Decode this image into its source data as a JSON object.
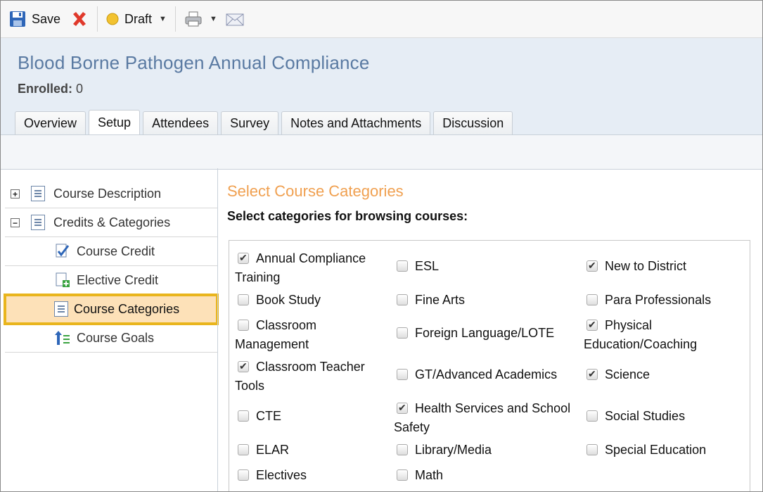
{
  "toolbar": {
    "save_label": "Save",
    "status_label": "Draft",
    "status_color": "#f2c230"
  },
  "course": {
    "title": "Blood Borne Pathogen Annual Compliance",
    "enrolled_label": "Enrolled:",
    "enrolled_count": "0"
  },
  "tabs": [
    {
      "label": "Overview"
    },
    {
      "label": "Setup",
      "active": true
    },
    {
      "label": "Attendees"
    },
    {
      "label": "Survey"
    },
    {
      "label": "Notes and Attachments"
    },
    {
      "label": "Discussion"
    }
  ],
  "sidebar": {
    "items": [
      {
        "label": "Course Description",
        "expander": "+",
        "level": "top"
      },
      {
        "label": "Credits & Categories",
        "expander": "−",
        "level": "top"
      },
      {
        "label": "Course Credit",
        "level": "sub"
      },
      {
        "label": "Elective Credit",
        "level": "sub"
      },
      {
        "label": "Course Categories",
        "level": "sub",
        "selected": true
      },
      {
        "label": "Course Goals",
        "level": "sub"
      }
    ]
  },
  "main": {
    "section_title": "Select Course Categories",
    "instructions": "Select categories for browsing courses:"
  },
  "categories": {
    "col1": [
      {
        "label1": "Annual Compliance",
        "label2": "Training",
        "checked": true
      },
      {
        "label1": "Book Study",
        "label2": "",
        "checked": false
      },
      {
        "label1": "Classroom",
        "label2": "Management",
        "checked": false
      },
      {
        "label1": "Classroom Teacher",
        "label2": "Tools",
        "checked": true
      },
      {
        "label1": "CTE",
        "label2": "",
        "checked": false
      },
      {
        "label1": "ELAR",
        "label2": "",
        "checked": false
      },
      {
        "label1": "Electives",
        "label2": "",
        "checked": false
      }
    ],
    "col2": [
      {
        "label1": "ESL",
        "label2": "",
        "checked": false
      },
      {
        "label1": "Fine Arts",
        "label2": "",
        "checked": false
      },
      {
        "label1": "Foreign Language/LOTE",
        "label2": "",
        "checked": false
      },
      {
        "label1": "GT/Advanced Academics",
        "label2": "",
        "checked": false
      },
      {
        "label1": "Health Services and School",
        "label2": "Safety",
        "checked": true
      },
      {
        "label1": "Library/Media",
        "label2": "",
        "checked": false
      },
      {
        "label1": "Math",
        "label2": "",
        "checked": false
      }
    ],
    "col3": [
      {
        "label1": "New to District",
        "label2": "",
        "checked": true
      },
      {
        "label1": "Para Professionals",
        "label2": "",
        "checked": false
      },
      {
        "label1": "Physical",
        "label2": "Education/Coaching",
        "checked": true
      },
      {
        "label1": "Science",
        "label2": "",
        "checked": true
      },
      {
        "label1": "Social Studies",
        "label2": "",
        "checked": false
      },
      {
        "label1": "Special Education",
        "label2": "",
        "checked": false
      }
    ]
  }
}
